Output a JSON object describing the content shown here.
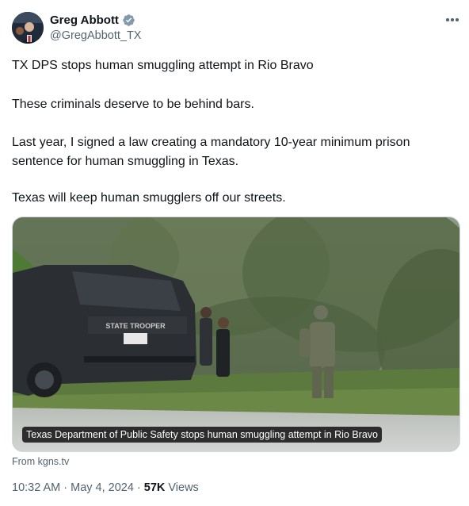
{
  "author": {
    "display_name": "Greg Abbott",
    "handle": "@GregAbbott_TX",
    "verified": true
  },
  "tweet": {
    "paragraphs": [
      "TX DPS stops human smuggling attempt in Rio Bravo",
      "These criminals deserve to be behind bars.",
      "Last year, I signed a law creating a mandatory 10-year minimum prison sentence for human smuggling in Texas.",
      "Texas will keep human smugglers off our streets."
    ]
  },
  "media": {
    "caption": "Texas Department of Public Safety stops human smuggling attempt in Rio Bravo",
    "vehicle_text": "STATE TROOPER",
    "source": "From kgns.tv"
  },
  "meta": {
    "time": "10:32 AM",
    "separator": "·",
    "date": "May 4, 2024",
    "views_count": "57K",
    "views_label": "Views"
  },
  "icons": {
    "verified": "verified-badge-icon",
    "more": "more-options-icon"
  },
  "colors": {
    "text_primary": "#0f1419",
    "text_secondary": "#536471",
    "verified_blue": "#829aab"
  }
}
